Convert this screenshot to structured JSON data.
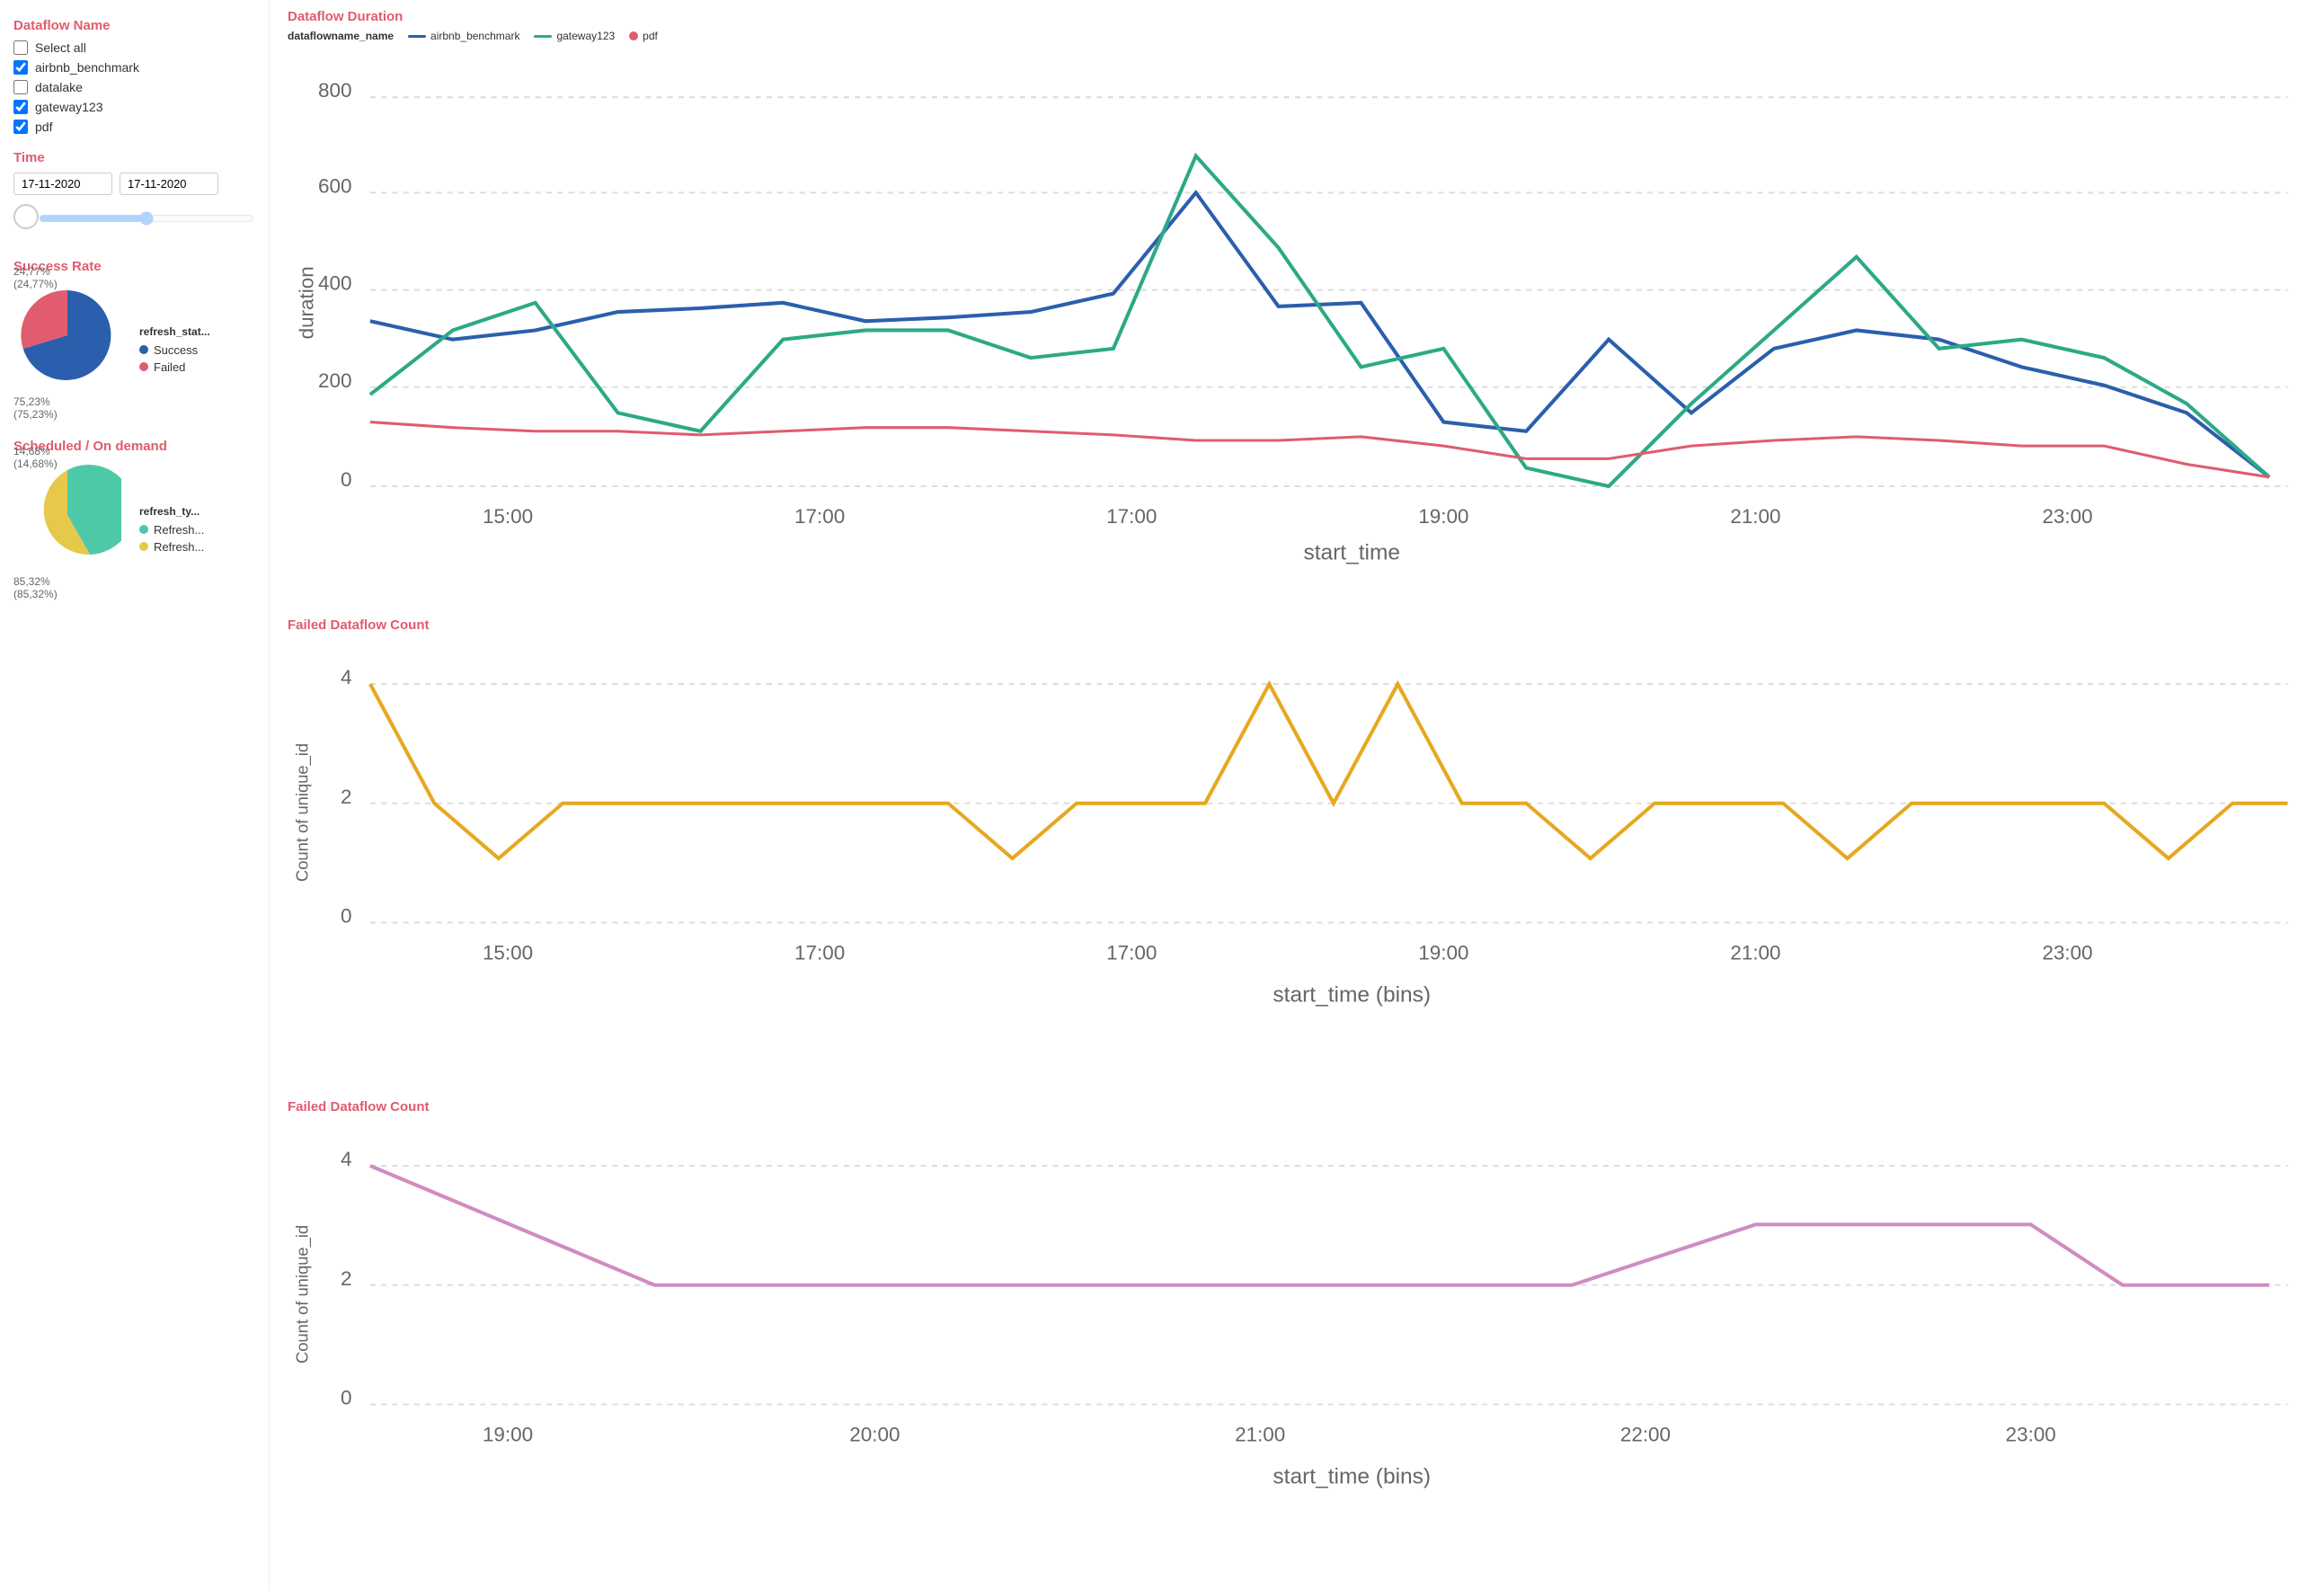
{
  "sidebar": {
    "dataflow_name_title": "Dataflow Name",
    "select_all_label": "Select all",
    "checkboxes": [
      {
        "label": "airbnb_benchmark",
        "checked": true
      },
      {
        "label": "datalake",
        "checked": false
      },
      {
        "label": "gateway123",
        "checked": true
      },
      {
        "label": "pdf",
        "checked": true
      }
    ],
    "time_title": "Time",
    "date_start": "17-11-2020",
    "date_end": "17-11-2020"
  },
  "charts": {
    "duration_title": "Dataflow Duration",
    "duration_legend_label": "dataflowname_name",
    "duration_legend_items": [
      {
        "label": "airbnb_benchmark",
        "color": "#2b5fad"
      },
      {
        "label": "gateway123",
        "color": "#2ca986"
      },
      {
        "label": "pdf",
        "color": "#e05c6e"
      }
    ],
    "duration_x_label": "start_time",
    "duration_y_label": "duration",
    "failed_count_title": "Failed Dataflow Count",
    "failed_count_x_label": "start_time (bins)",
    "failed_count_y_label": "Count of unique_id",
    "failed_count2_title": "Failed Dataflow Count",
    "failed_count2_x_label": "start_time (bins)",
    "failed_count2_y_label": "Count of unique_id"
  },
  "success_rate": {
    "title": "Success Rate",
    "legend_title": "refresh_stat...",
    "success_label": "Success",
    "success_color": "#2b5fad",
    "failed_label": "Failed",
    "failed_color": "#e05c6e",
    "success_pct": "75,23%",
    "success_pct2": "(75,23%)",
    "failed_pct": "24,77%",
    "failed_pct2": "(24,77%)"
  },
  "scheduled": {
    "title": "Scheduled / On demand",
    "legend_title": "refresh_ty...",
    "refresh1_label": "Refresh...",
    "refresh1_color": "#4ec9a8",
    "refresh2_label": "Refresh...",
    "refresh2_color": "#e6c84a",
    "pct1": "85,32%",
    "pct1b": "(85,32%)",
    "pct2": "14,68%",
    "pct2b": "(14,68%)"
  }
}
